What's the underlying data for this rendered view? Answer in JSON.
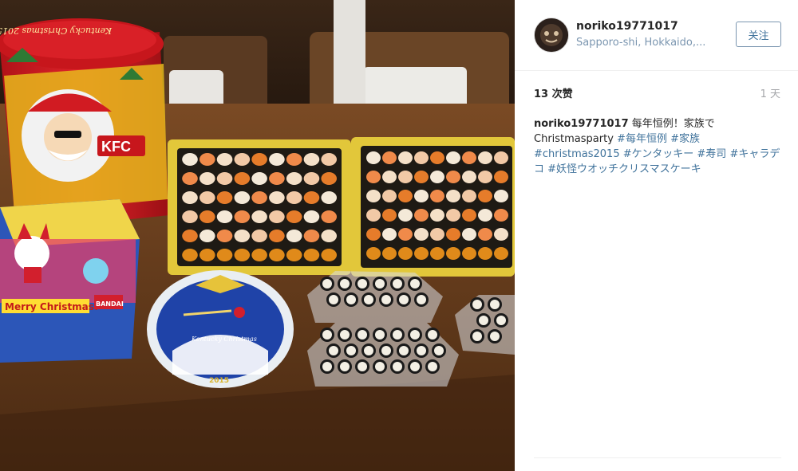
{
  "post": {
    "username": "noriko19771017",
    "location": "Sapporo-shi, Hokkaido,...",
    "follow_label": "关注",
    "likes": "13 次赞",
    "age": "1 天",
    "caption_text": "每年恒例！家族で Christmasparty",
    "hashtags": [
      "#每年恒例",
      "#家族",
      "#christmas2015",
      "#ケンタッキー",
      "#寿司",
      "#キャラデコ",
      "#妖怪ウオッチクリスマスケーキ"
    ]
  },
  "photo": {
    "bucket_brand": "KFC",
    "bucket_script": "Kentucky Christmas 2015",
    "cake_box_text": "Merry Christmas!",
    "cake_box_brand": "BANDAI",
    "plate_script": "Kentucky Christmas",
    "plate_year": "2015"
  }
}
